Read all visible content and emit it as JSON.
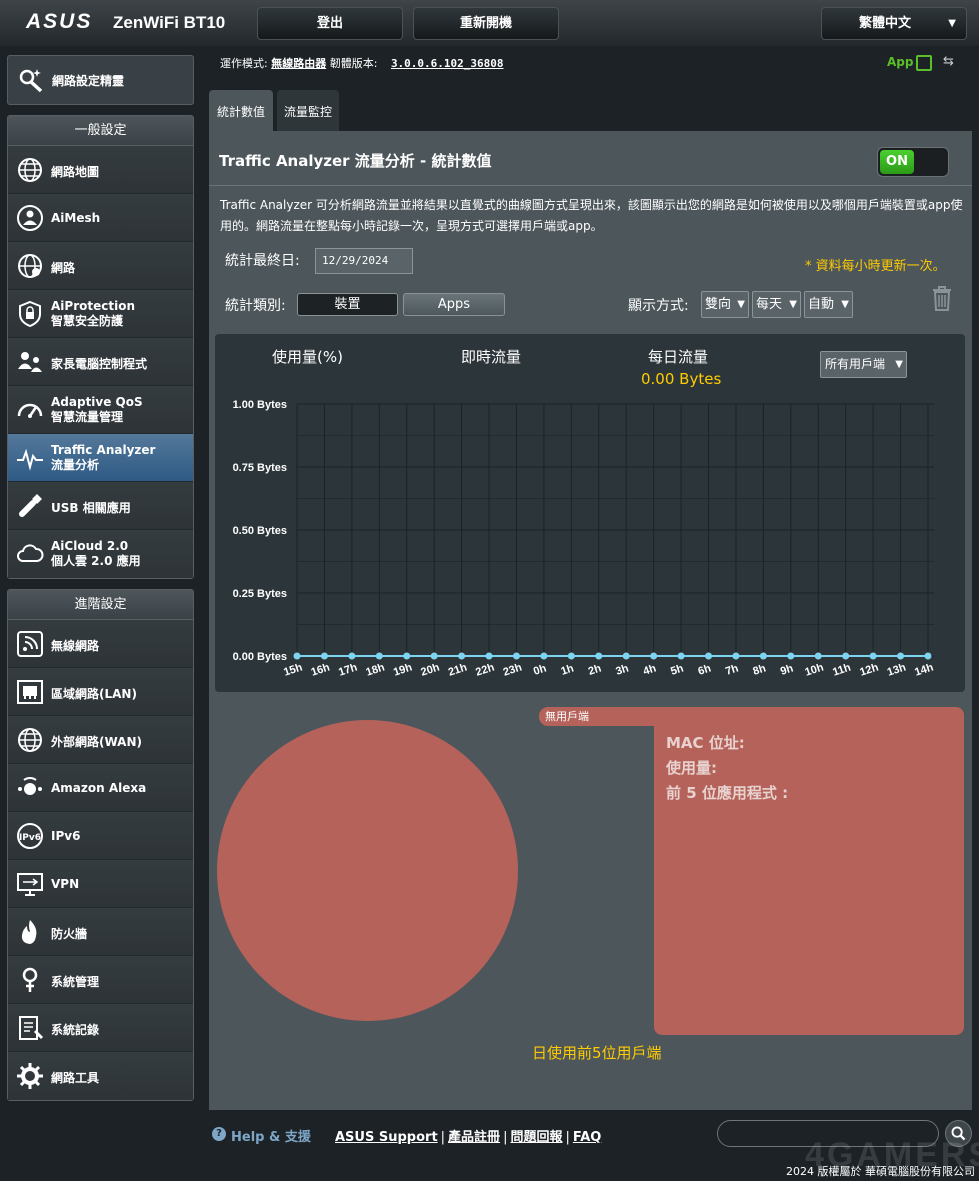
{
  "header": {
    "brand": "ASUS",
    "model": "ZenWiFi BT10",
    "logout_label": "登出",
    "reboot_label": "重新開機",
    "language": "繁體中文"
  },
  "status": {
    "mode_label": "運作模式:",
    "mode_value": "無線路由器",
    "fw_label": "韌體版本:",
    "fw_value": "3.0.0.6.102_36808",
    "app_label": "App"
  },
  "sidebar": {
    "qis_label": "網路設定精靈",
    "general_title": "一般設定",
    "general": [
      {
        "label": "網路地圖",
        "icon": "network-map-icon"
      },
      {
        "label": "AiMesh",
        "icon": "aimesh-icon"
      },
      {
        "label": "網路",
        "icon": "guest-network-icon"
      },
      {
        "label": "AiProtection",
        "label2": "智慧安全防護",
        "icon": "aiprotection-icon"
      },
      {
        "label": "家長電腦控制程式",
        "icon": "parental-control-icon"
      },
      {
        "label": "Adaptive QoS",
        "label2": "智慧流量管理",
        "icon": "qos-icon"
      },
      {
        "label": "Traffic Analyzer",
        "label2": "流量分析",
        "icon": "traffic-analyzer-icon"
      },
      {
        "label": "USB 相關應用",
        "icon": "usb-icon"
      },
      {
        "label": "AiCloud 2.0",
        "label2": "個人雲 2.0 應用",
        "icon": "aicloud-icon"
      }
    ],
    "advanced_title": "進階設定",
    "advanced": [
      {
        "label": "無線網路",
        "icon": "wireless-icon"
      },
      {
        "label": "區域網路(LAN)",
        "icon": "lan-icon"
      },
      {
        "label": "外部網路(WAN)",
        "icon": "wan-icon"
      },
      {
        "label": "Amazon Alexa",
        "icon": "alexa-icon"
      },
      {
        "label": "IPv6",
        "icon": "ipv6-icon"
      },
      {
        "label": "VPN",
        "icon": "vpn-icon"
      },
      {
        "label": "防火牆",
        "icon": "firewall-icon"
      },
      {
        "label": "系統管理",
        "icon": "administration-icon"
      },
      {
        "label": "系統記錄",
        "icon": "system-log-icon"
      },
      {
        "label": "網路工具",
        "icon": "network-tools-icon"
      }
    ]
  },
  "tabs": {
    "stats": "統計數值",
    "monitor": "流量監控"
  },
  "page": {
    "title": "Traffic Analyzer 流量分析 - 統計數值",
    "toggle": "ON",
    "description": "Traffic Analyzer 可分析網路流量並將結果以直覺式的曲線圖方式呈現出來，該圖顯示出您的網路是如何被使用以及哪個用戶端裝置或app使用的。網路流量在整點每小時記錄一次，呈現方式可選擇用戶端或app。",
    "date_label": "統計最終日:",
    "date_value": "12/29/2024",
    "note": "* 資料每小時更新一次。",
    "type_label": "統計類別:",
    "type_device": "裝置",
    "type_apps": "Apps",
    "display_label": "顯示方式:",
    "display_dir": "雙向",
    "display_period": "每天",
    "display_unit": "自動"
  },
  "chart": {
    "tab_usage": "使用量(%)",
    "tab_realtime": "即時流量",
    "tab_daily": "每日流量",
    "daily_total": "0.00 Bytes",
    "client_select": "所有用戶端"
  },
  "chart_data": {
    "type": "line",
    "x": [
      "15h",
      "16h",
      "17h",
      "18h",
      "19h",
      "20h",
      "21h",
      "22h",
      "23h",
      "0h",
      "1h",
      "2h",
      "3h",
      "4h",
      "5h",
      "6h",
      "7h",
      "8h",
      "9h",
      "10h",
      "11h",
      "12h",
      "13h",
      "14h"
    ],
    "series": [
      {
        "values": [
          0,
          0,
          0,
          0,
          0,
          0,
          0,
          0,
          0,
          0,
          0,
          0,
          0,
          0,
          0,
          0,
          0,
          0,
          0,
          0,
          0,
          0,
          0,
          0
        ]
      }
    ],
    "y_ticks": [
      "0.00 Bytes",
      "0.25 Bytes",
      "0.50 Bytes",
      "0.75 Bytes",
      "1.00 Bytes"
    ],
    "ylim": [
      0,
      1
    ],
    "grid": true,
    "colors": {
      "line": "#7ed4f0",
      "grid": "#1c2326",
      "axis_text": "#ffffff"
    }
  },
  "pie": {
    "label": "無用戶端",
    "mac_label": "MAC 位址:",
    "usage_label": "使用量:",
    "top_apps_label": "前 5 位應用程式 :",
    "caption": "日使用前5位用戶端",
    "color": "#b5625a"
  },
  "footer": {
    "help": "Help & 支援",
    "links": [
      "ASUS Support",
      "產品註冊",
      "問題回報",
      "FAQ"
    ],
    "copyright": "2024 版權屬於 華碩電腦股份有限公司",
    "watermark": "4GAMERS"
  }
}
